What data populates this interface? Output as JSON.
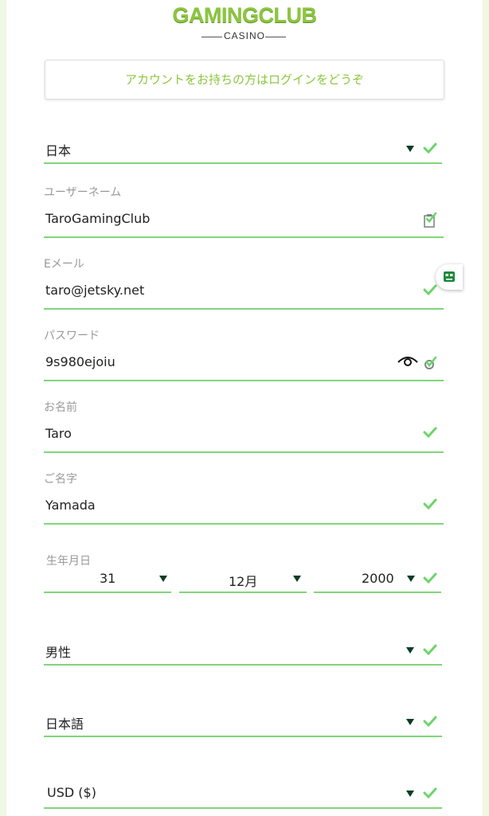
{
  "logo": {
    "main": "GAMINGCLUB",
    "sub": "CASINO"
  },
  "login_banner": "アカウントをお持ちの方はログインをどうぞ",
  "country": {
    "value": "日本"
  },
  "username": {
    "label": "ユーザーネーム",
    "value": "TaroGamingClub"
  },
  "email": {
    "label": "Eメール",
    "value": "taro@jetsky.net"
  },
  "password": {
    "label": "パスワード",
    "value": "9s980ejoiu"
  },
  "first_name": {
    "label": "お名前",
    "value": "Taro"
  },
  "last_name": {
    "label": "ご名字",
    "value": "Yamada"
  },
  "dob": {
    "label": "生年月日",
    "day": "31",
    "month": "12月",
    "year": "2000"
  },
  "gender": {
    "value": "男性"
  },
  "language": {
    "value": "日本語"
  },
  "currency": {
    "value": "USD ($)"
  },
  "colors": {
    "accent": "#8cc63f",
    "underline": "#7fd67a",
    "check": "#6cd46a",
    "arrow": "#0a3d25"
  },
  "icons": [
    "dropdown-arrow-icon",
    "check-icon",
    "eye-icon",
    "refresh-icon",
    "clipboard-icon",
    "chat-bot-icon"
  ]
}
